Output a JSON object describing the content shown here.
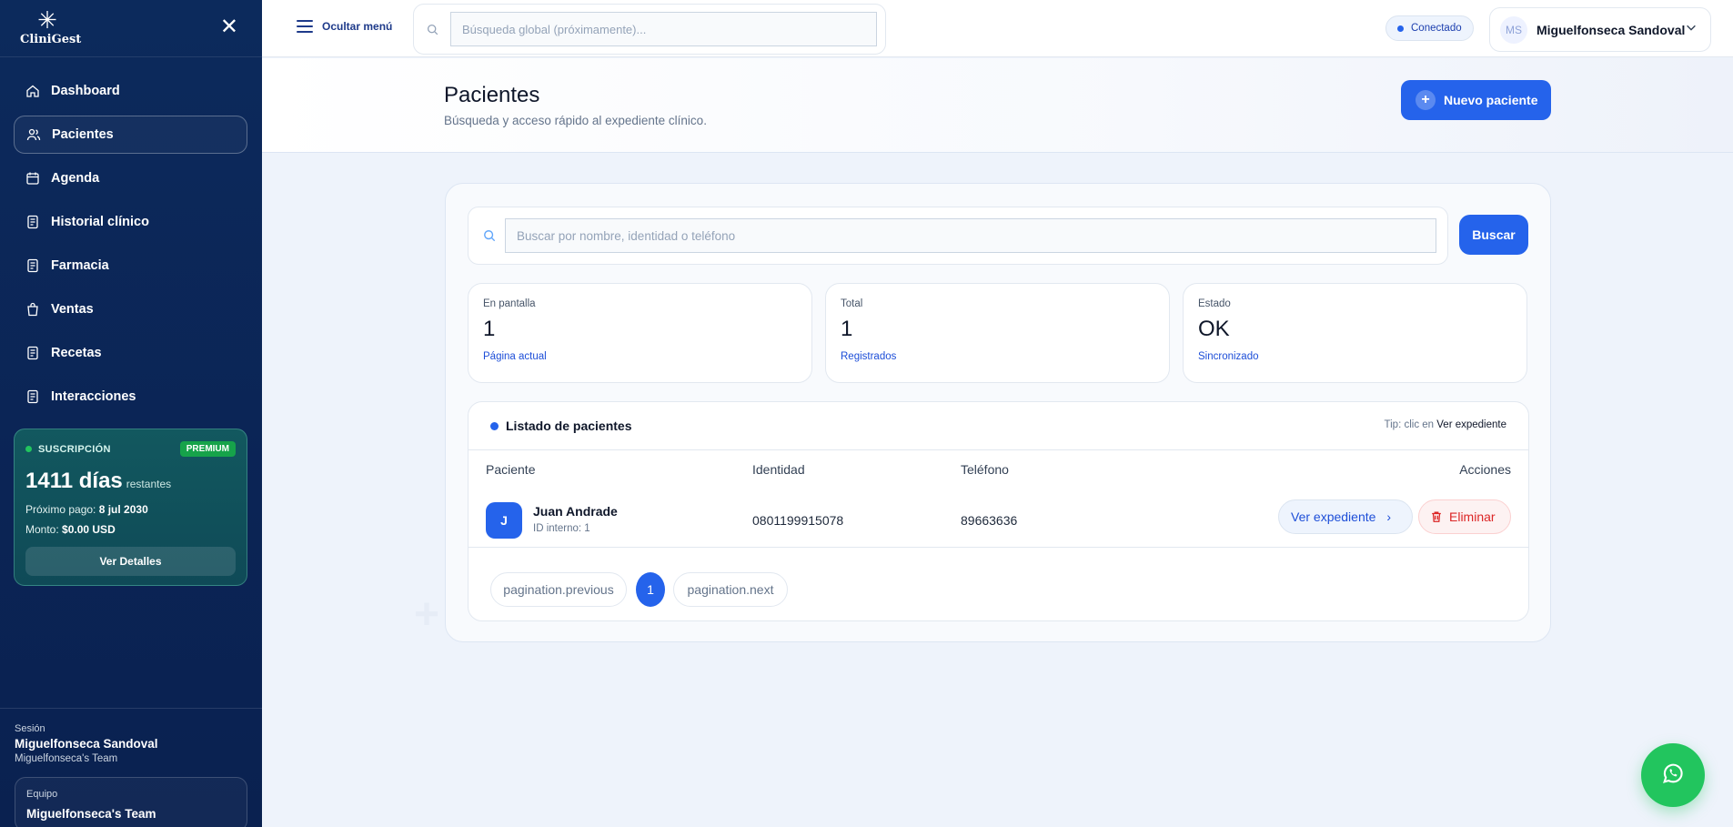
{
  "sidebar": {
    "logo_text": "CliniGest",
    "nav": [
      {
        "label": "Dashboard",
        "icon": "home-icon"
      },
      {
        "label": "Pacientes",
        "icon": "users-icon",
        "active": true
      },
      {
        "label": "Agenda",
        "icon": "calendar-icon"
      },
      {
        "label": "Historial clínico",
        "icon": "file-icon"
      },
      {
        "label": "Farmacia",
        "icon": "file-icon"
      },
      {
        "label": "Ventas",
        "icon": "bag-icon"
      },
      {
        "label": "Recetas",
        "icon": "file-icon"
      },
      {
        "label": "Interacciones",
        "icon": "file-icon"
      }
    ],
    "subscription": {
      "label": "SUSCRIPCIÓN",
      "badge": "PREMIUM",
      "days": "1411 días",
      "days_suffix": "restantes",
      "next_payment_label": "Próximo pago:",
      "next_payment": "8 jul 2030",
      "amount_label": "Monto:",
      "amount": "$0.00 USD",
      "details_button": "Ver Detalles"
    },
    "session": {
      "label": "Sesión",
      "name": "Miguelfonseca Sandoval",
      "team": "Miguelfonseca's Team"
    },
    "team_box": {
      "label": "Equipo",
      "name": "Miguelfonseca's Team"
    }
  },
  "topbar": {
    "menu_label": "Ocultar menú",
    "search_placeholder": "Búsqueda global (próximamente)...",
    "status": "Conectado",
    "user_initials": "MS",
    "user_name": "Miguelfonseca Sandoval"
  },
  "page": {
    "title": "Pacientes",
    "subtitle": "Búsqueda y acceso rápido al expediente clínico.",
    "new_button": "Nuevo paciente"
  },
  "search": {
    "placeholder": "Buscar por nombre, identidad o teléfono",
    "button": "Buscar"
  },
  "stats": [
    {
      "label": "En pantalla",
      "value": "1",
      "footer": "Página actual"
    },
    {
      "label": "Total",
      "value": "1",
      "footer": "Registrados"
    },
    {
      "label": "Estado",
      "value": "OK",
      "footer": "Sincronizado"
    }
  ],
  "list": {
    "title": "Listado de pacientes",
    "tip_prefix": "Tip: clic en",
    "tip_action": "Ver expediente",
    "columns": [
      "Paciente",
      "Identidad",
      "Teléfono",
      "Acciones"
    ],
    "rows": [
      {
        "initial": "J",
        "name": "Juan Andrade",
        "internal_id": "ID interno: 1",
        "identity": "0801199915078",
        "phone": "89663636",
        "view": "Ver expediente",
        "delete": "Eliminar"
      }
    ],
    "pagination": {
      "previous": "pagination.previous",
      "current": "1",
      "next": "pagination.next"
    }
  },
  "colors": {
    "accent": "#2563eb",
    "sidebar": "#0c2a5c",
    "danger": "#dc2626",
    "whatsapp": "#22c55e"
  }
}
